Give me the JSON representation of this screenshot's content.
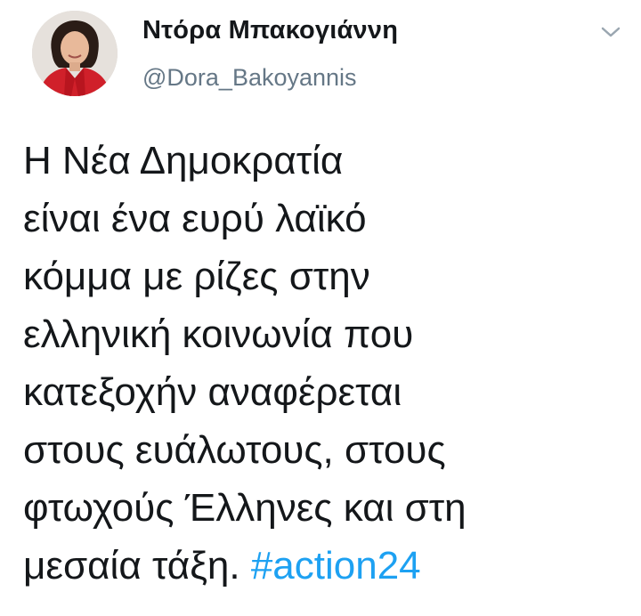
{
  "tweet": {
    "author_name": "Ντόρα Μπακογιάννη",
    "author_handle": "@Dora_Bakoyannis",
    "text_lines": [
      "Η Νέα Δημοκρατία",
      "είναι ένα ευρύ λαϊκό",
      "κόμμα με ρίζες στην",
      "ελληνική κοινωνία που",
      "κατεξοχήν αναφέρεται",
      "στους ευάλωτους, στους",
      "φτωχούς Έλληνες και στη"
    ],
    "last_line_text": "μεσαία τάξη.",
    "hashtag": "#action24",
    "avatar_icon": "profile-photo",
    "menu_icon": "chevron-down-icon"
  },
  "colors": {
    "text": "#14171a",
    "secondary": "#657786",
    "link": "#1da1f2",
    "avatar_jacket": "#d0202a"
  }
}
